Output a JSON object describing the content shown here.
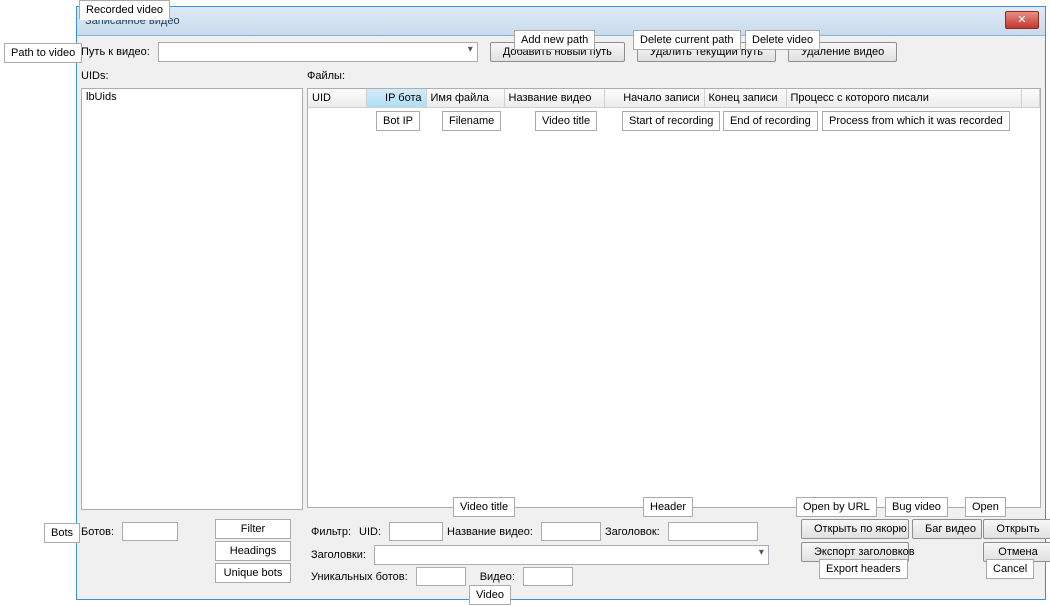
{
  "window": {
    "title": "Записанное видео"
  },
  "tabs": {
    "recorded_video": "Recorded video"
  },
  "annotations": {
    "path_to_video": "Path to video",
    "bots": "Bots",
    "add_new_path": "Add new path",
    "delete_current_path": "Delete current path",
    "delete_video": "Delete video",
    "bot_ip": "Bot IP",
    "filename": "Filename",
    "video_title_col": "Video title",
    "start_recording": "Start of recording",
    "end_recording": "End of recording",
    "process_from": "Process from which it was recorded",
    "video_title": "Video title",
    "header": "Header",
    "filter": "Filter",
    "headings": "Headings",
    "unique_bots": "Unique bots",
    "open_by_url": "Open by URL",
    "bug_video": "Bug video",
    "open": "Open",
    "export_headers": "Export headers",
    "cancel": "Cancel",
    "video": "Video"
  },
  "labels": {
    "path": "Путь к видео:",
    "uids": "UIDs:",
    "files": "Файлы:",
    "bots": "Ботов:",
    "filter": "Фильтр:",
    "uid": "UID:",
    "video_title_ru": "Название видео:",
    "header_ru": "Заголовок:",
    "headings_ru": "Заголовки:",
    "unique_bots_ru": "Уникальных ботов:",
    "video_ru": "Видео:"
  },
  "buttons": {
    "add_path": "Добавить новый путь",
    "delete_path": "Удалить текущий путь",
    "delete_video": "Удаление видео",
    "open_anchor": "Открыть по якорю",
    "bug_video_ru": "Баг видео",
    "open_ru": "Открыть",
    "export_headers_ru": "Экспорт заголовков",
    "cancel_ru": "Отмена"
  },
  "uid_list": {
    "item0": "lbUids"
  },
  "grid": {
    "cols": {
      "uid": "UID",
      "ip": "IP бота",
      "filename": "Имя файла",
      "title": "Название видео",
      "start": "Начало записи",
      "end": "Конец записи",
      "process": "Процесс с которого писали"
    }
  }
}
